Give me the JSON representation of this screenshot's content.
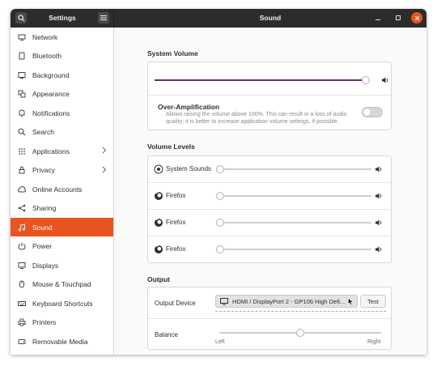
{
  "header": {
    "left_title": "Settings",
    "title": "Sound"
  },
  "sidebar": {
    "items": [
      {
        "label": "Network",
        "icon": "network-icon"
      },
      {
        "label": "Bluetooth",
        "icon": "bluetooth-icon"
      },
      {
        "label": "Background",
        "icon": "background-icon"
      },
      {
        "label": "Appearance",
        "icon": "appearance-icon"
      },
      {
        "label": "Notifications",
        "icon": "notifications-icon"
      },
      {
        "label": "Search",
        "icon": "search-icon"
      },
      {
        "label": "Applications",
        "icon": "applications-icon",
        "has_chevron": true
      },
      {
        "label": "Privacy",
        "icon": "privacy-icon",
        "has_chevron": true
      },
      {
        "label": "Online Accounts",
        "icon": "online-accounts-icon"
      },
      {
        "label": "Sharing",
        "icon": "sharing-icon"
      },
      {
        "label": "Sound",
        "icon": "music-note-icon",
        "active": true
      },
      {
        "label": "Power",
        "icon": "power-icon"
      },
      {
        "label": "Displays",
        "icon": "displays-icon"
      },
      {
        "label": "Mouse & Touchpad",
        "icon": "mouse-icon"
      },
      {
        "label": "Keyboard Shortcuts",
        "icon": "keyboard-icon"
      },
      {
        "label": "Printers",
        "icon": "printer-icon"
      },
      {
        "label": "Removable Media",
        "icon": "removable-media-icon"
      }
    ]
  },
  "system_volume": {
    "section_title": "System Volume",
    "level": 0.98,
    "over_amplification": {
      "title": "Over-Amplification",
      "description_line1": "Allows raising the volume above 100%. This can result in a loss of audio",
      "description_line2": "quality; it is better to increase application volume settings, if possible.",
      "enabled": false
    }
  },
  "volume_levels": {
    "section_title": "Volume Levels",
    "streams": [
      {
        "label": "System Sounds",
        "icon": "system-sounds-icon",
        "level": 0.0
      },
      {
        "label": "Firefox",
        "icon": "firefox-icon",
        "level": 0.0
      },
      {
        "label": "Firefox",
        "icon": "firefox-icon",
        "level": 0.0
      },
      {
        "label": "Firefox",
        "icon": "firefox-icon",
        "level": 0.0
      }
    ]
  },
  "output": {
    "section_title": "Output",
    "device_label": "Output Device",
    "device_value": "HDMI / DisplayPort 2 - GP106 High Defi...",
    "test_label": "Test",
    "balance_label": "Balance",
    "balance_left": "Left",
    "balance_right": "Right",
    "balance_value": 0.5
  },
  "colors": {
    "accent": "#e95420",
    "slider_fill": "#6d2a6d",
    "headerbar": "#2c2c2c"
  }
}
